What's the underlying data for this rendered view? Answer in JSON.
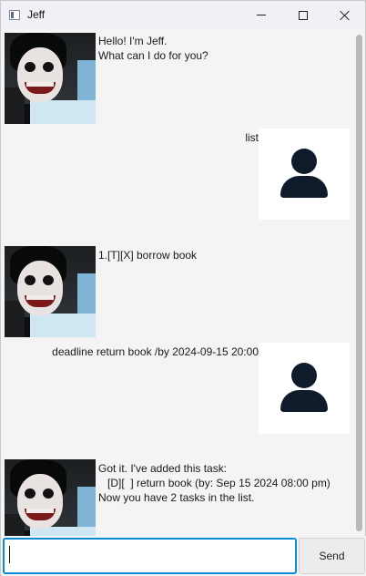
{
  "window": {
    "title": "Jeff"
  },
  "messages": [
    {
      "sender": "jeff",
      "lines": "Hello! I'm Jeff.\nWhat can I do for you?"
    },
    {
      "sender": "user",
      "lines": "list"
    },
    {
      "sender": "jeff",
      "lines": "1.[T][X] borrow book"
    },
    {
      "sender": "user",
      "lines": "deadline return book /by 2024-09-15 20:00"
    },
    {
      "sender": "jeff",
      "lines": "Got it. I've added this task:\n   [D][  ] return book (by: Sep 15 2024 08:00 pm)\nNow you have 2 tasks in the list."
    }
  ],
  "input": {
    "value": "",
    "placeholder": ""
  },
  "send_label": "Send",
  "colors": {
    "input_border": "#0a8bd8",
    "user_icon": "#0f1b2b",
    "chat_bg": "#f4f4f4"
  }
}
